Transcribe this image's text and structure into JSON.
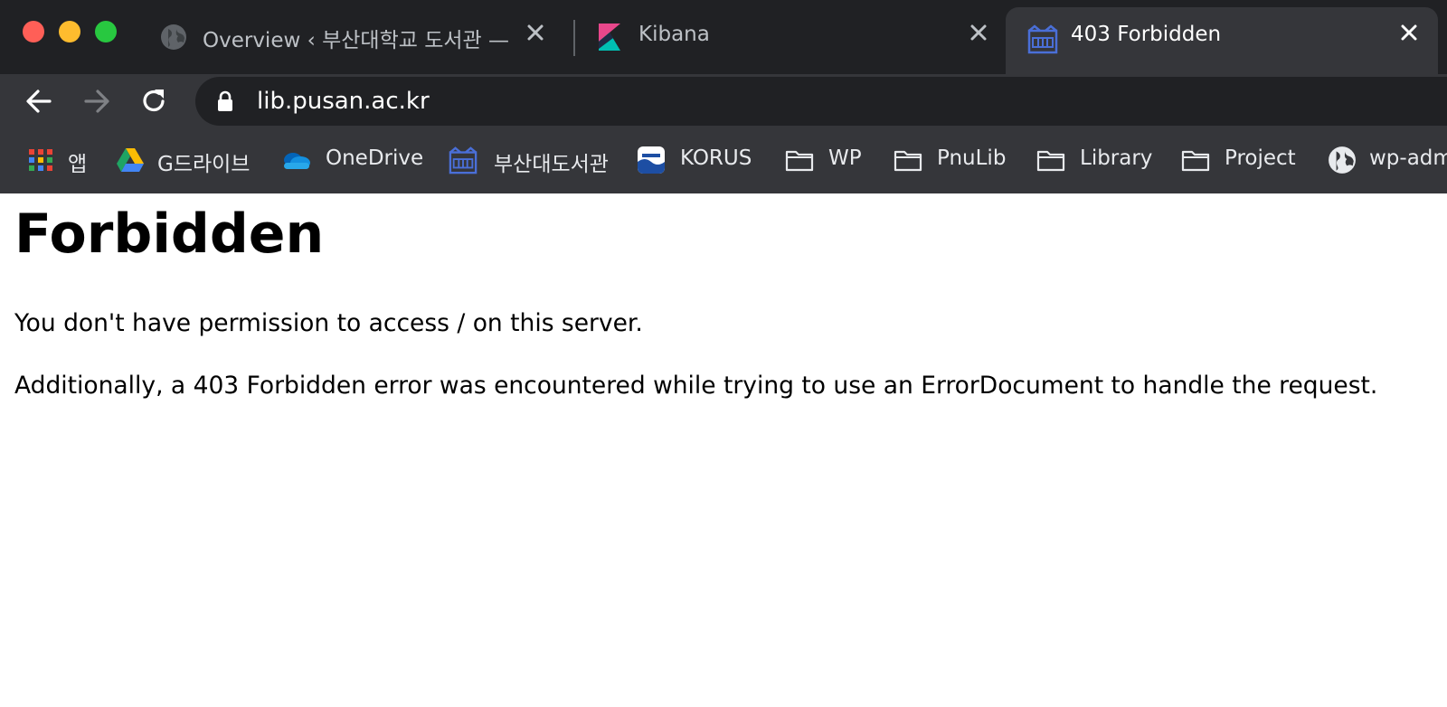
{
  "window": {
    "traffic_lights": {
      "close": "#ff5f57",
      "minimize": "#febc2e",
      "maximize": "#28c840"
    }
  },
  "tabs": [
    {
      "title": "Overview ‹ 부산대학교 도서관 — 워",
      "icon": "globe-icon",
      "active": false
    },
    {
      "title": "Kibana",
      "icon": "kibana-logo-icon",
      "active": false
    },
    {
      "title": "403 Forbidden",
      "icon": "pnu-library-icon",
      "active": true
    }
  ],
  "navbar": {
    "url": "lib.pusan.ac.kr"
  },
  "bookmarks": [
    {
      "label": "앱",
      "icon": "apps-grid-icon"
    },
    {
      "label": "G드라이브",
      "icon": "google-drive-icon"
    },
    {
      "label": "OneDrive",
      "icon": "onedrive-cloud-icon"
    },
    {
      "label": "부산대도서관",
      "icon": "pnu-library-icon"
    },
    {
      "label": "KORUS",
      "icon": "korus-icon"
    },
    {
      "label": "WP",
      "icon": "folder-icon"
    },
    {
      "label": "PnuLib",
      "icon": "folder-icon"
    },
    {
      "label": "Library",
      "icon": "folder-icon"
    },
    {
      "label": "Project",
      "icon": "folder-icon"
    },
    {
      "label": "wp-adm",
      "icon": "globe-icon"
    }
  ],
  "page": {
    "heading": "Forbidden",
    "paragraphs": [
      "You don't have permission to access / on this server.",
      "Additionally, a 403 Forbidden error was encountered while trying to use an ErrorDocument to handle the request."
    ]
  }
}
